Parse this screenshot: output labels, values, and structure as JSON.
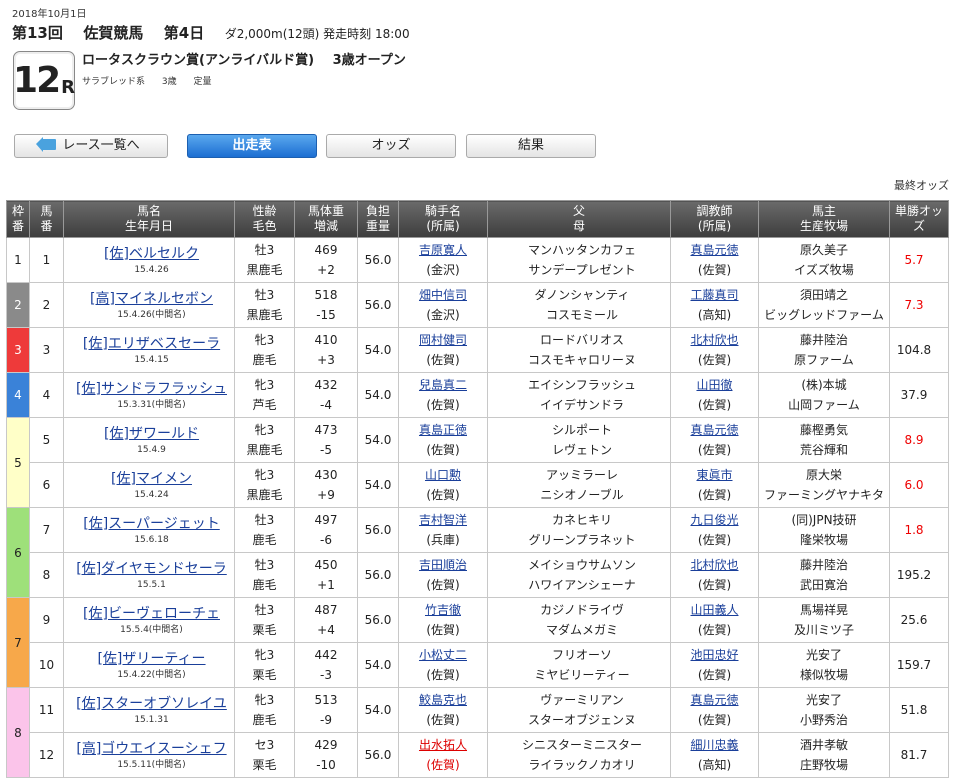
{
  "header": {
    "date": "2018年10月1日",
    "kai": "第13回",
    "course": "佐賀競馬",
    "day": "第4日",
    "info": "ダ2,000m(12頭) 発走時刻 18:00",
    "race_number": "12",
    "race_suffix": "R",
    "race_name": "ロータスクラウン賞(アンライバルド賞)",
    "race_class": "3歳オープン",
    "attr_breed": "サラブレッド系",
    "attr_age": "3歳",
    "attr_weight": "定量"
  },
  "nav": {
    "back_label": "レース一覧へ",
    "tab_shutuba": "出走表",
    "tab_odds": "オッズ",
    "tab_result": "結果"
  },
  "last_odds_label": "最終オッズ",
  "table": {
    "headers": {
      "waku_1": "枠",
      "waku_2": "番",
      "umaban_1": "馬",
      "umaban_2": "番",
      "horse_1": "馬名",
      "horse_2": "生年月日",
      "sex_1": "性齢",
      "sex_2": "毛色",
      "weight_1": "馬体重",
      "weight_2": "増減",
      "kinryo_1": "負担",
      "kinryo_2": "重量",
      "jockey_1": "騎手名",
      "jockey_2": "(所属)",
      "sire_1": "父",
      "sire_2": "母",
      "trainer_1": "調教師",
      "trainer_2": "(所属)",
      "owner_1": "馬主",
      "owner_2": "生産牧場",
      "odds": "単勝オッズ"
    },
    "waku_colors": {
      "1": "#ffffff",
      "2": "#8a8a8a",
      "3": "#ee3a3a",
      "4": "#3a82d8",
      "5": "#ffffc8",
      "6": "#9ee07a",
      "7": "#f7a84a",
      "8": "#fbc4ea"
    },
    "rows": [
      {
        "waku": "1",
        "num": "1",
        "horse": "[佐]ベルセルク",
        "birth": "15.4.26",
        "sex": "牡3",
        "color": "黒鹿毛",
        "weight": "469",
        "diff": "+2",
        "kinryo": "56.0",
        "jockey": "吉原寛人",
        "jockey_aff": "(金沢)",
        "sire": "マンハッタンカフェ",
        "dam": "サンデープレゼント",
        "trainer": "真島元徳",
        "trainer_aff": "(佐賀)",
        "owner": "原久美子",
        "breeder": "イズズ牧場",
        "odds": "5.7",
        "odds_hot": true
      },
      {
        "waku": "2",
        "num": "2",
        "horse": "[高]マイネルセボン",
        "birth": "15.4.26(中間名)",
        "sex": "牡3",
        "color": "黒鹿毛",
        "weight": "518",
        "diff": "-15",
        "kinryo": "56.0",
        "jockey": "畑中信司",
        "jockey_aff": "(金沢)",
        "sire": "ダノンシャンティ",
        "dam": "コスモミール",
        "trainer": "工藤真司",
        "trainer_aff": "(高知)",
        "owner": "須田靖之",
        "breeder": "ビッグレッドファーム",
        "odds": "7.3",
        "odds_hot": true
      },
      {
        "waku": "3",
        "num": "3",
        "horse": "[佐]エリザベスセーラ",
        "birth": "15.4.15",
        "sex": "牝3",
        "color": "鹿毛",
        "weight": "410",
        "diff": "+3",
        "kinryo": "54.0",
        "jockey": "岡村健司",
        "jockey_aff": "(佐賀)",
        "sire": "ロードバリオス",
        "dam": "コスモキャロリーヌ",
        "trainer": "北村欣也",
        "trainer_aff": "(佐賀)",
        "owner": "藤井陸治",
        "breeder": "原ファーム",
        "odds": "104.8",
        "odds_hot": false
      },
      {
        "waku": "4",
        "num": "4",
        "horse": "[佐]サンドラフラッシュ",
        "birth": "15.3.31(中間名)",
        "sex": "牝3",
        "color": "芦毛",
        "weight": "432",
        "diff": "-4",
        "kinryo": "54.0",
        "jockey": "兒島真二",
        "jockey_aff": "(佐賀)",
        "sire": "エイシンフラッシュ",
        "dam": "イイデサンドラ",
        "trainer": "山田徹",
        "trainer_aff": "(佐賀)",
        "owner": "(株)本城",
        "breeder": "山岡ファーム",
        "odds": "37.9",
        "odds_hot": false
      },
      {
        "waku": "5",
        "num": "5",
        "horse": "[佐]ザワールド",
        "birth": "15.4.9",
        "sex": "牝3",
        "color": "黒鹿毛",
        "weight": "473",
        "diff": "-5",
        "kinryo": "54.0",
        "jockey": "真島正徳",
        "jockey_aff": "(佐賀)",
        "sire": "シルポート",
        "dam": "レヴェトン",
        "trainer": "真島元徳",
        "trainer_aff": "(佐賀)",
        "owner": "藤樫勇気",
        "breeder": "荒谷輝和",
        "odds": "8.9",
        "odds_hot": true
      },
      {
        "waku": "5",
        "num": "6",
        "horse": "[佐]マイメン",
        "birth": "15.4.24",
        "sex": "牝3",
        "color": "黒鹿毛",
        "weight": "430",
        "diff": "+9",
        "kinryo": "54.0",
        "jockey": "山口勲",
        "jockey_aff": "(佐賀)",
        "sire": "アッミラーレ",
        "dam": "ニシオノーブル",
        "trainer": "東眞市",
        "trainer_aff": "(佐賀)",
        "owner": "原大栄",
        "breeder": "ファーミングヤナキタ",
        "odds": "6.0",
        "odds_hot": true
      },
      {
        "waku": "6",
        "num": "7",
        "horse": "[佐]スーパージェット",
        "birth": "15.6.18",
        "sex": "牡3",
        "color": "鹿毛",
        "weight": "497",
        "diff": "-6",
        "kinryo": "56.0",
        "jockey": "吉村智洋",
        "jockey_aff": "(兵庫)",
        "sire": "カネヒキリ",
        "dam": "グリーンプラネット",
        "trainer": "九日俊光",
        "trainer_aff": "(佐賀)",
        "owner": "(同)JPN技研",
        "breeder": "隆栄牧場",
        "odds": "1.8",
        "odds_hot": true
      },
      {
        "waku": "6",
        "num": "8",
        "horse": "[佐]ダイヤモンドセーラ",
        "birth": "15.5.1",
        "sex": "牡3",
        "color": "鹿毛",
        "weight": "450",
        "diff": "+1",
        "kinryo": "56.0",
        "jockey": "吉田順治",
        "jockey_aff": "(佐賀)",
        "sire": "メイショウサムソン",
        "dam": "ハワイアンシェーナ",
        "trainer": "北村欣也",
        "trainer_aff": "(佐賀)",
        "owner": "藤井陸治",
        "breeder": "武田寛治",
        "odds": "195.2",
        "odds_hot": false
      },
      {
        "waku": "7",
        "num": "9",
        "horse": "[佐]ビーヴェローチェ",
        "birth": "15.5.4(中間名)",
        "sex": "牡3",
        "color": "栗毛",
        "weight": "487",
        "diff": "+4",
        "kinryo": "56.0",
        "jockey": "竹吉徹",
        "jockey_aff": "(佐賀)",
        "sire": "カジノドライヴ",
        "dam": "マダムメガミ",
        "trainer": "山田義人",
        "trainer_aff": "(佐賀)",
        "owner": "馬場祥晃",
        "breeder": "及川ミツ子",
        "odds": "25.6",
        "odds_hot": false
      },
      {
        "waku": "7",
        "num": "10",
        "horse": "[佐]ザリーティー",
        "birth": "15.4.22(中間名)",
        "sex": "牝3",
        "color": "栗毛",
        "weight": "442",
        "diff": "-3",
        "kinryo": "54.0",
        "jockey": "小松丈二",
        "jockey_aff": "(佐賀)",
        "sire": "フリオーソ",
        "dam": "ミヤビリーティー",
        "trainer": "池田忠好",
        "trainer_aff": "(佐賀)",
        "owner": "光安了",
        "breeder": "様似牧場",
        "odds": "159.7",
        "odds_hot": false
      },
      {
        "waku": "8",
        "num": "11",
        "horse": "[佐]スターオブソレイユ",
        "birth": "15.1.31",
        "sex": "牝3",
        "color": "鹿毛",
        "weight": "513",
        "diff": "-9",
        "kinryo": "54.0",
        "jockey": "鮫島克也",
        "jockey_aff": "(佐賀)",
        "sire": "ヴァーミリアン",
        "dam": "スターオブジェンヌ",
        "trainer": "真島元徳",
        "trainer_aff": "(佐賀)",
        "owner": "光安了",
        "breeder": "小野秀治",
        "odds": "51.8",
        "odds_hot": false
      },
      {
        "waku": "8",
        "num": "12",
        "horse": "[高]ゴウエイスーシェフ",
        "birth": "15.5.11(中間名)",
        "sex": "セ3",
        "color": "栗毛",
        "weight": "429",
        "diff": "-10",
        "kinryo": "56.0",
        "jockey": "出水拓人",
        "jockey_aff": "(佐賀)",
        "jockey_red": true,
        "sire": "シニスターミニスター",
        "dam": "ライラックノカオリ",
        "trainer": "細川忠義",
        "trainer_aff": "(高知)",
        "owner": "酒井孝敏",
        "breeder": "庄野牧場",
        "odds": "81.7",
        "odds_hot": false
      }
    ]
  }
}
